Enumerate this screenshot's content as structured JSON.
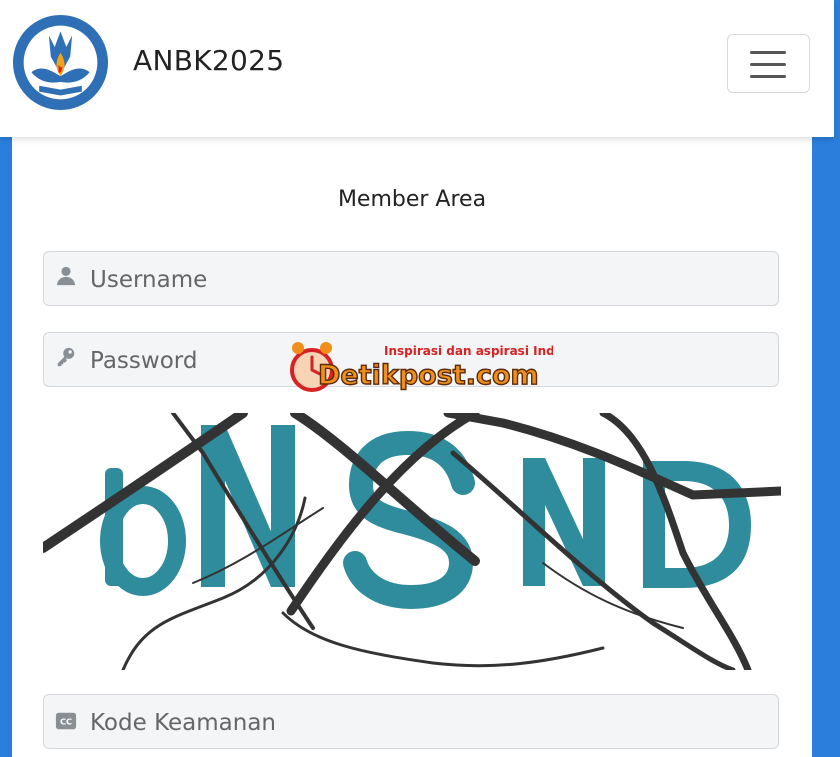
{
  "header": {
    "brand": "ANBK2025",
    "logo_text": "TUT WURI HANDAYANI",
    "menu_icon": "hamburger-icon"
  },
  "login": {
    "title": "Member Area",
    "username": {
      "placeholder": "Username",
      "value": "",
      "icon": "user-icon"
    },
    "password": {
      "placeholder": "Password",
      "value": "",
      "icon": "key-icon"
    },
    "captcha": {
      "text": "bNSND"
    },
    "security_code": {
      "placeholder": "Kode Keamanan",
      "value": "",
      "icon": "cc-icon"
    }
  },
  "watermark": {
    "tagline": "Inspirasi dan aspirasi Indonesia",
    "name": "Detikpost.com"
  },
  "colors": {
    "background": "#2a7fdc",
    "captcha_letters": "#2f8c9c",
    "captcha_lines": "#333333",
    "watermark_red": "#d62222",
    "watermark_orange": "#f0901a"
  }
}
